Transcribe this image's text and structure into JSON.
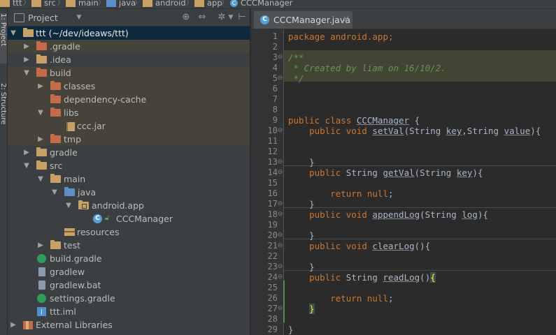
{
  "breadcrumb": {
    "items": [
      "ttt",
      "src",
      "main",
      "java",
      "android",
      "app",
      "CCCManager"
    ]
  },
  "toolstrip": {
    "tabs": [
      "1: Project",
      "2: Structure"
    ]
  },
  "project_panel": {
    "title": "Project",
    "tree": [
      {
        "label": "ttt (~/dev/ideaws/ttt)",
        "arrow": "▼",
        "depth": 0,
        "icon": "module-folder-icon"
      },
      {
        "label": ".gradle",
        "arrow": "▶",
        "depth": 1,
        "icon": "excluded-folder-icon"
      },
      {
        "label": ".idea",
        "arrow": "▶",
        "depth": 1,
        "icon": "folder-icon"
      },
      {
        "label": "build",
        "arrow": "▼",
        "depth": 1,
        "icon": "excluded-folder-icon"
      },
      {
        "label": "classes",
        "arrow": "▶",
        "depth": 2,
        "icon": "excluded-folder-icon"
      },
      {
        "label": "dependency-cache",
        "arrow": "",
        "depth": 2,
        "icon": "excluded-folder-icon"
      },
      {
        "label": "libs",
        "arrow": "▼",
        "depth": 2,
        "icon": "excluded-folder-icon"
      },
      {
        "label": "ccc.jar",
        "arrow": "",
        "depth": 3,
        "icon": "jar-icon"
      },
      {
        "label": "tmp",
        "arrow": "▶",
        "depth": 2,
        "icon": "excluded-folder-icon"
      },
      {
        "label": "gradle",
        "arrow": "▶",
        "depth": 1,
        "icon": "folder-icon"
      },
      {
        "label": "src",
        "arrow": "▼",
        "depth": 1,
        "icon": "folder-icon"
      },
      {
        "label": "main",
        "arrow": "▼",
        "depth": 2,
        "icon": "folder-icon"
      },
      {
        "label": "java",
        "arrow": "▼",
        "depth": 3,
        "icon": "source-folder-icon"
      },
      {
        "label": "android.app",
        "arrow": "▼",
        "depth": 4,
        "icon": "package-icon"
      },
      {
        "label": "CCCManager",
        "arrow": "",
        "depth": 5,
        "icon": "class-icon"
      },
      {
        "label": "resources",
        "arrow": "",
        "depth": 3,
        "icon": "resources-folder-icon"
      },
      {
        "label": "test",
        "arrow": "▶",
        "depth": 2,
        "icon": "folder-icon"
      },
      {
        "label": "build.gradle",
        "arrow": "",
        "depth": 1,
        "icon": "gradle-icon"
      },
      {
        "label": "gradlew",
        "arrow": "",
        "depth": 1,
        "icon": "file-icon"
      },
      {
        "label": "gradlew.bat",
        "arrow": "",
        "depth": 1,
        "icon": "file-icon"
      },
      {
        "label": "settings.gradle",
        "arrow": "",
        "depth": 1,
        "icon": "gradle-icon"
      },
      {
        "label": "ttt.iml",
        "arrow": "",
        "depth": 1,
        "icon": "iml-icon"
      },
      {
        "label": "External Libraries",
        "arrow": "▶",
        "depth": 0,
        "icon": "libraries-icon"
      }
    ]
  },
  "editor": {
    "tab_label": "CCCManager.java",
    "tab_close": "×",
    "line_numbers": [
      "1",
      "2",
      "3",
      "4",
      "5",
      "6",
      "7",
      "8",
      "9",
      "10",
      "11",
      "12",
      "13",
      "14",
      "15",
      "16",
      "17",
      "18",
      "19",
      "20",
      "21",
      "22",
      "23",
      "24",
      "25",
      "26",
      "27",
      "28",
      "29"
    ],
    "code": {
      "l1": "package android.app;",
      "l3": "/**",
      "l4": " * Created by liam on 16/10/2.",
      "l5": " */",
      "l9_kw": "public class ",
      "l9_name": "CCCManager",
      "l9_rest": " {",
      "l10_kw": "    public void ",
      "l10_name": "setVal",
      "l10_a": "(String ",
      "l10_p1": "key",
      "l10_b": ",String ",
      "l10_p2": "value",
      "l10_c": "){",
      "l13": "    }",
      "l14_kw": "    public ",
      "l14_a": "String ",
      "l14_name": "getVal",
      "l14_b": "(String ",
      "l14_p1": "key",
      "l14_c": "){",
      "l16_kw": "        return null",
      "l16_rest": ";",
      "l17": "    }",
      "l18_kw": "    public void ",
      "l18_name": "appendLog",
      "l18_a": "(String ",
      "l18_p1": "log",
      "l18_c": "){",
      "l20": "    }",
      "l21_kw": "    public void ",
      "l21_name": "clearLog",
      "l21_c": "(){",
      "l23": "    }",
      "l24_kw": "    public ",
      "l24_a": "String ",
      "l24_name": "readLog",
      "l24_b": "()",
      "l24_brace": "{",
      "l26_kw": "        return null",
      "l26_rest": ";",
      "l27_pre": "    ",
      "l27_brace": "}",
      "l29": "}"
    }
  }
}
